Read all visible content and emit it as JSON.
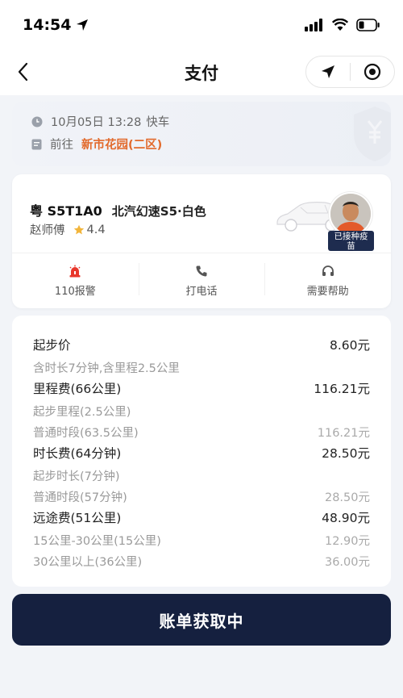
{
  "status_bar": {
    "time": "14:54"
  },
  "nav": {
    "title": "支付"
  },
  "trip": {
    "datetime": "10月05日 13:28",
    "ride_type": "快车",
    "dest_prefix": "前往",
    "destination": "新市花园(二区)"
  },
  "driver": {
    "plate": "粤 S5T1A0",
    "car_model": "北汽幻速S5·白色",
    "name": "赵师傅",
    "rating": "4.4",
    "vaccine_badge_line1": "已接种疫",
    "vaccine_badge_line2": "苗"
  },
  "actions": [
    {
      "label": "110报警",
      "icon": "alarm-icon"
    },
    {
      "label": "打电话",
      "icon": "phone-icon"
    },
    {
      "label": "需要帮助",
      "icon": "headset-icon"
    }
  ],
  "fees": [
    {
      "label": "起步价",
      "amount": "8.60元",
      "kind": "main"
    },
    {
      "label": "含时长7分钟,含里程2.5公里",
      "amount": "",
      "kind": "sub"
    },
    {
      "label": "里程费(66公里)",
      "amount": "116.21元",
      "kind": "main"
    },
    {
      "label": "起步里程(2.5公里)",
      "amount": "",
      "kind": "sub"
    },
    {
      "label": "普通时段(63.5公里)",
      "amount": "116.21元",
      "kind": "sub"
    },
    {
      "label": "时长费(64分钟)",
      "amount": "28.50元",
      "kind": "main"
    },
    {
      "label": "起步时长(7分钟)",
      "amount": "",
      "kind": "sub"
    },
    {
      "label": "普通时段(57分钟)",
      "amount": "28.50元",
      "kind": "sub"
    },
    {
      "label": "远途费(51公里)",
      "amount": "48.90元",
      "kind": "main"
    },
    {
      "label": "15公里-30公里(15公里)",
      "amount": "12.90元",
      "kind": "sub"
    },
    {
      "label": "30公里以上(36公里)",
      "amount": "36.00元",
      "kind": "sub"
    }
  ],
  "cta": {
    "label": "账单获取中"
  },
  "colors": {
    "accent_orange": "#e26a2c",
    "navy": "#15203f",
    "alarm_red": "#e8372c"
  }
}
